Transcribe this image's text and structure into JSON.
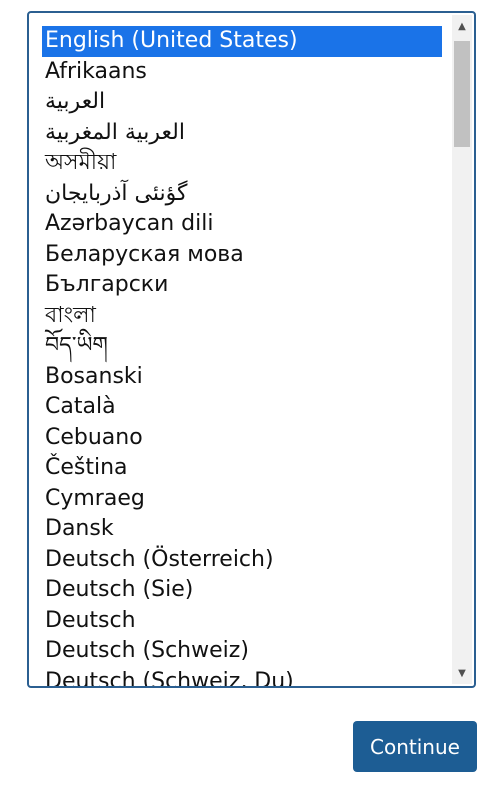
{
  "languages": [
    "English (United States)",
    "Afrikaans",
    "العربية",
    "العربية المغربية",
    "অসমীয়া",
    "گؤنئی آذربایجان",
    "Azərbaycan dili",
    "Беларуская мова",
    "Български",
    "বাংলা",
    "བོད་ཡིག",
    "Bosanski",
    "Català",
    "Cebuano",
    "Čeština",
    "Cymraeg",
    "Dansk",
    "Deutsch (Österreich)",
    "Deutsch (Sie)",
    "Deutsch",
    "Deutsch (Schweiz)",
    "Deutsch (Schweiz, Du)"
  ],
  "selected_index": 0,
  "scrollbar": {
    "up_icon": "▲",
    "down_icon": "▼"
  },
  "continue_label": "Continue",
  "colors": {
    "selection": "#1a73e8",
    "button": "#1d5d94",
    "border": "#2b5f91"
  }
}
